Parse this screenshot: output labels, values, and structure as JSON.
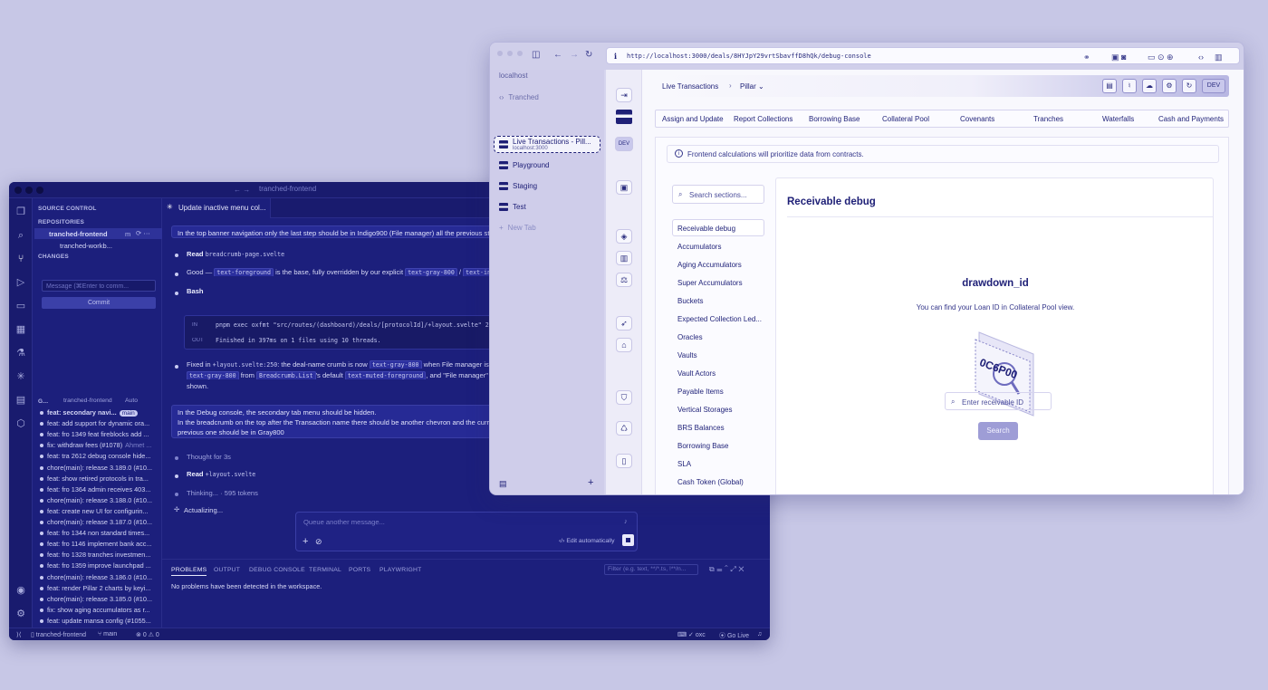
{
  "vscode": {
    "title": "tranched-frontend",
    "sidebar": {
      "header": "SOURCE CONTROL",
      "repositories_label": "REPOSITORIES",
      "repo_main": "tranched-frontend",
      "repo_main_branch": "m",
      "repo_sub": "tranched-workb...",
      "changes_label": "CHANGES",
      "message_placeholder": "Message (⌘Enter to comm...",
      "commit_label": "Commit",
      "graph_header": "G...",
      "graph_repo": "tranched-frontend",
      "graph_auto": "Auto",
      "graph_branch_badge": "main",
      "commits": [
        {
          "msg": "feat: secondary navi...",
          "meta": ""
        },
        {
          "msg": "feat: add support for dynamic ora...",
          "meta": ""
        },
        {
          "msg": "feat: fro 1349 feat fireblocks add ...",
          "meta": ""
        },
        {
          "msg": "fix: withdraw fees (#1078)",
          "meta": "Ahmet ..."
        },
        {
          "msg": "feat: tra 2612 debug console hide...",
          "meta": ""
        },
        {
          "msg": "chore(main): release 3.189.0 (#10...",
          "meta": ""
        },
        {
          "msg": "feat: show retired protocols in tra...",
          "meta": ""
        },
        {
          "msg": "feat: fro 1364 admin receives 403...",
          "meta": ""
        },
        {
          "msg": "chore(main): release 3.188.0 (#10...",
          "meta": ""
        },
        {
          "msg": "feat: create new UI for configurin...",
          "meta": ""
        },
        {
          "msg": "chore(main): release 3.187.0 (#10...",
          "meta": ""
        },
        {
          "msg": "feat: fro 1344 non standard times...",
          "meta": ""
        },
        {
          "msg": "feat: fro 1146 implement bank acc...",
          "meta": ""
        },
        {
          "msg": "feat: fro 1328 tranches investmen...",
          "meta": ""
        },
        {
          "msg": "feat: fro 1359 improve launchpad ...",
          "meta": ""
        },
        {
          "msg": "chore(main): release 3.186.0 (#10...",
          "meta": ""
        },
        {
          "msg": "feat: render Pillar 2 charts by keyi...",
          "meta": ""
        },
        {
          "msg": "chore(main): release 3.185.0 (#10...",
          "meta": ""
        },
        {
          "msg": "fix: show aging accumulators as r...",
          "meta": ""
        },
        {
          "msg": "feat: update mansa config (#1055...",
          "meta": ""
        }
      ]
    },
    "chat": {
      "tab_title": "Update inactive menu col...",
      "bubble1": "In the top banner navigation only the last step should be in Indigo900 (File manager) all the previous st",
      "read1_label": "Read",
      "read1_file": "breadcrumb-page.svelte",
      "good_prefix": "Good —",
      "good_code1": "text-foreground",
      "good_mid": "is the base, fully overridden by our explicit",
      "good_code2": "text-gray-800",
      "good_sep": "/",
      "good_code3": "text-indi",
      "bash_label": "Bash",
      "bash_in_label": "IN",
      "bash_in": "pnpm exec oxfmt \"src/routes/(dashboard)/deals/[protocolId]/+layout.svelte\" 2>&1 | ta",
      "bash_out_label": "OUT",
      "bash_out": "Finished in 397ms on 1 files using 10 threads.",
      "fixed_prefix": "Fixed in",
      "fixed_file": "+layout.svelte:250",
      "fixed_mid": ": the deal-name crumb is now",
      "fixed_code1": "text-gray-800",
      "fixed_end": "when File manager is the",
      "fixed2_code1": "text-gray-800",
      "fixed2_from": "from",
      "fixed2_code2": "Breadcrumb.List",
      "fixed2_mid": "'s default",
      "fixed2_code3": "text-muted-foreground",
      "fixed2_end": ", and \"File manager\" (a",
      "fixed3": "shown.",
      "bubble2_l1": "In the Debug console, the secondary tab menu should be hidden.",
      "bubble2_l2": "In the breadcrumb on the top after the Transaction name there should be another chevron and the curr",
      "bubble2_l3": "previous one should be in Gray800",
      "thought": "Thought for 3s",
      "read2_label": "Read",
      "read2_file": "+layout.svelte",
      "thinking": "Thinking... · 595 tokens",
      "actualizing": "Actualizing...",
      "queue_placeholder": "Queue another message...",
      "edit_auto": "Edit automatically"
    },
    "panel": {
      "tabs": [
        "PROBLEMS",
        "OUTPUT",
        "DEBUG CONSOLE",
        "TERMINAL",
        "PORTS",
        "PLAYWRIGHT"
      ],
      "filter_placeholder": "Filter (e.g. text, **/*.ts, !**/n...",
      "message": "No problems have been detected in the workspace."
    },
    "status": {
      "repo": "tranched-frontend",
      "branch": "main",
      "errors": "0",
      "warnings": "0",
      "right1": "oxc",
      "go_live": "Go Live"
    }
  },
  "browser": {
    "url": "http://localhost:3000/deals/8HYJpY29vrtSbavffD8hQk/debug-console",
    "sidebar": {
      "host": "localhost",
      "items": [
        {
          "label": "Tranched"
        },
        {
          "label": "Live Transactions - Pill...",
          "sub": "localhost:3000"
        },
        {
          "label": "Playground"
        },
        {
          "label": "Staging"
        },
        {
          "label": "Test"
        }
      ],
      "new_tab": "New Tab"
    },
    "app": {
      "rail_dev": "DEV",
      "breadcrumb": [
        "Live Transactions",
        "Pillar"
      ],
      "dev_badge": "DEV",
      "tabs": [
        "Assign and Update",
        "Report Collections",
        "Borrowing Base",
        "Collateral Pool",
        "Covenants",
        "Tranches",
        "Waterfalls",
        "Cash and Payments"
      ],
      "info": "Frontend calculations will prioritize data from contracts.",
      "search_placeholder": "Search sections...",
      "sections": [
        "Receivable debug",
        "Accumulators",
        "Aging Accumulators",
        "Super Accumulators",
        "Buckets",
        "Expected Collection Led...",
        "Oracles",
        "Vaults",
        "Vault Actors",
        "Payable Items",
        "Vertical Storages",
        "BRS Balances",
        "Borrowing Base",
        "SLA",
        "Cash Token (Global)"
      ],
      "panel_title": "Receivable debug",
      "field_title": "drawdown_id",
      "field_hint": "You can find your Loan ID in Collateral Pool view.",
      "illustration_text": "0C6P00",
      "input_placeholder": "Enter receivable ID",
      "search_button": "Search"
    }
  }
}
